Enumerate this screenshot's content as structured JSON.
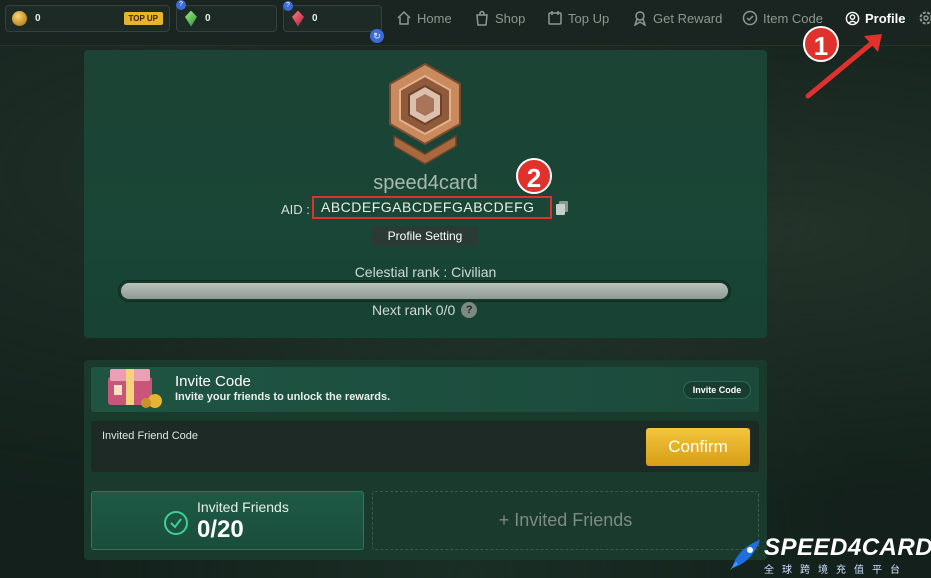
{
  "wallets": {
    "coins": {
      "value": "0",
      "button": "TOP UP"
    },
    "green_gems": {
      "value": "0",
      "help": "?"
    },
    "red_gems": {
      "value": "0",
      "help": "?"
    },
    "refresh": "↻"
  },
  "nav": {
    "items": [
      {
        "label": "Home",
        "icon": "home-icon"
      },
      {
        "label": "Shop",
        "icon": "shop-bag-icon"
      },
      {
        "label": "Top Up",
        "icon": "wallet-icon"
      },
      {
        "label": "Get Reward",
        "icon": "reward-icon"
      },
      {
        "label": "Item Code",
        "icon": "check-circle-icon"
      },
      {
        "label": "Profile",
        "icon": "user-circle-icon",
        "active": true
      }
    ],
    "settings_icon": "gear-icon"
  },
  "profile": {
    "username": "speed4card",
    "aid_label": "AID :",
    "aid_value": "ABCDEFGABCDEFGABCDEFG",
    "profile_setting_label": "Profile Setting",
    "rank_label": "Celestial rank : Civilian",
    "rank_progress": 0,
    "next_rank_label": "Next rank 0/0",
    "help": "?"
  },
  "invite": {
    "title": "Invite Code",
    "subtitle": "Invite your friends to unlock the rewards.",
    "invite_code_button": "Invite Code",
    "field_label": "Invited Friend Code",
    "confirm_label": "Confirm",
    "invited_friends_label": "Invited Friends",
    "invited_friends_count": "0/20",
    "add_friends_label": "+ Invited Friends"
  },
  "annotations": {
    "marker_1": "1",
    "marker_2": "2"
  },
  "watermark": {
    "brand": "SPEED4CARD",
    "tagline": "全球跨境充值平台"
  },
  "colors": {
    "accent_gold": "#e8b42a",
    "annotation_red": "#e0312d",
    "card_green": "#1c4335"
  }
}
